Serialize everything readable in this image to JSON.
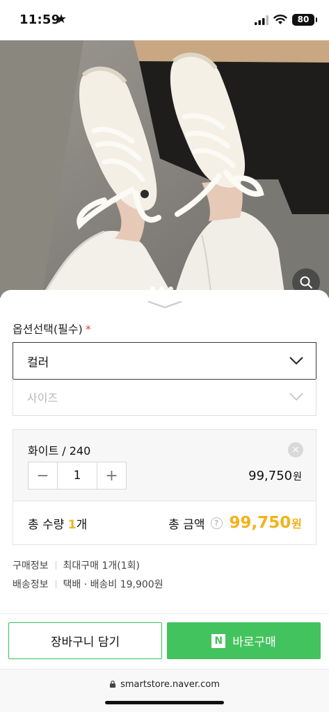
{
  "status_bar": {
    "time": "11:59",
    "battery": "80"
  },
  "icons": {
    "star": "star-icon",
    "signal": "signal-icon",
    "wifi": "wifi-icon",
    "zoom": "search-icon",
    "chevron": "chevron-down-icon",
    "close": "close-icon",
    "lock": "lock-icon",
    "help": "question-icon"
  },
  "options": {
    "title": "옵션선택(필수)",
    "required_mark": "*",
    "color_select": "컬러",
    "size_select": "사이즈"
  },
  "selected_option": {
    "name": "화이트 / 240",
    "minus": "−",
    "quantity": "1",
    "plus": "+",
    "price": "99,750",
    "price_unit": "원",
    "remove": "×"
  },
  "total": {
    "qty_prefix": "총 수량 ",
    "qty_num": "1",
    "qty_suffix": "개",
    "label": "총 금액",
    "help": "?",
    "price": "99,750",
    "price_unit": "원"
  },
  "info": [
    {
      "key": "구매정보",
      "value": "최대구매 1개(1회)"
    },
    {
      "key": "배송정보",
      "value": "택배 · 배송비 19,900원"
    }
  ],
  "actions": {
    "cart": "장바구니 담기",
    "naver_logo": "N",
    "buy": "바로구매"
  },
  "browser": {
    "url": "smartstore.naver.com"
  },
  "colors": {
    "accent_yellow": "#f2b21c",
    "naver_green": "#43c35e",
    "required_red": "#e0473c"
  }
}
